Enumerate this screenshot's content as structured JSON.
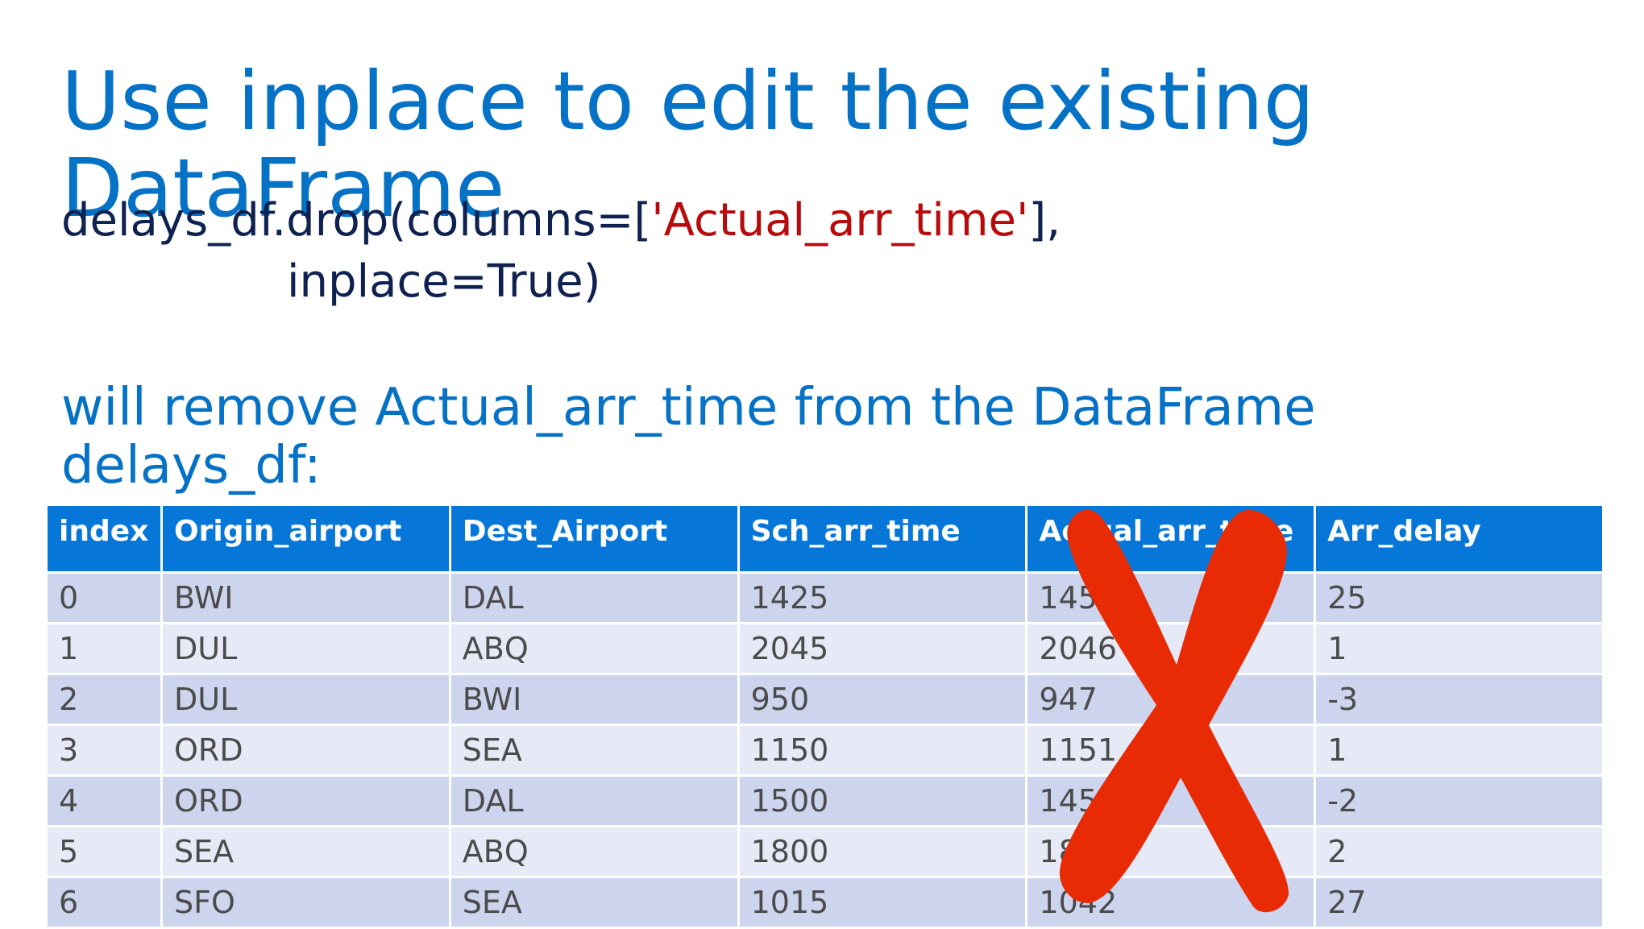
{
  "title": "Use inplace to edit the existing\nDataFrame",
  "code": {
    "prefix": "delays_df.drop(columns=[",
    "string_arg": "'Actual_arr_time'",
    "suffix": "],",
    "line2": "inplace=True)"
  },
  "description": "will remove Actual_arr_time from the DataFrame\ndelays_df:",
  "table": {
    "headers": [
      "index",
      "Origin_airport",
      "Dest_Airport",
      "Sch_arr_time",
      "Actual_arr_time",
      "Arr_delay"
    ],
    "rows": [
      [
        "0",
        "BWI",
        "DAL",
        "1425",
        "1450",
        "25"
      ],
      [
        "1",
        "DUL",
        "ABQ",
        "2045",
        "2046",
        "1"
      ],
      [
        "2",
        "DUL",
        "BWI",
        "950",
        "947",
        "-3"
      ],
      [
        "3",
        "ORD",
        "SEA",
        "1150",
        "1151",
        "1"
      ],
      [
        "4",
        "ORD",
        "DAL",
        "1500",
        "1458",
        "-2"
      ],
      [
        "5",
        "SEA",
        "ABQ",
        "1800",
        "1802",
        "2"
      ],
      [
        "6",
        "SFO",
        "SEA",
        "1015",
        "1042",
        "27"
      ]
    ]
  },
  "icons": {
    "cross": "red-x-icon"
  },
  "colors": {
    "title": "#0672c6",
    "code": "#0e2150",
    "code_string": "#b80c0c",
    "header_bg": "#0677d8",
    "row_odd": "#cdd5ee",
    "row_even": "#e6eaf6",
    "cross": "#e82b05"
  }
}
